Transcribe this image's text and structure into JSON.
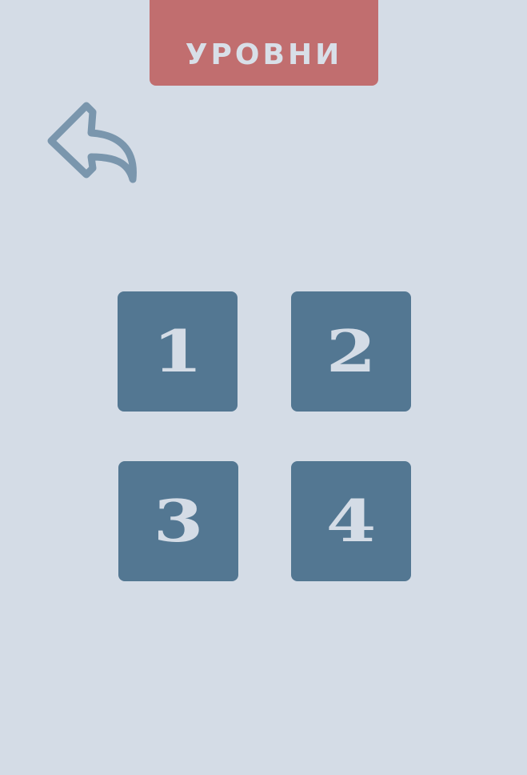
{
  "header": {
    "title": "УРОВНИ"
  },
  "back_button": {
    "icon": "back-arrow-icon"
  },
  "levels": [
    {
      "number": "1"
    },
    {
      "number": "2"
    },
    {
      "number": "3"
    },
    {
      "number": "4"
    }
  ],
  "colors": {
    "background": "#d4dce6",
    "title_banner": "#c16e6f",
    "tile": "#537792",
    "tile_text": "#d4dce6",
    "back_icon": "#7a96ad"
  }
}
